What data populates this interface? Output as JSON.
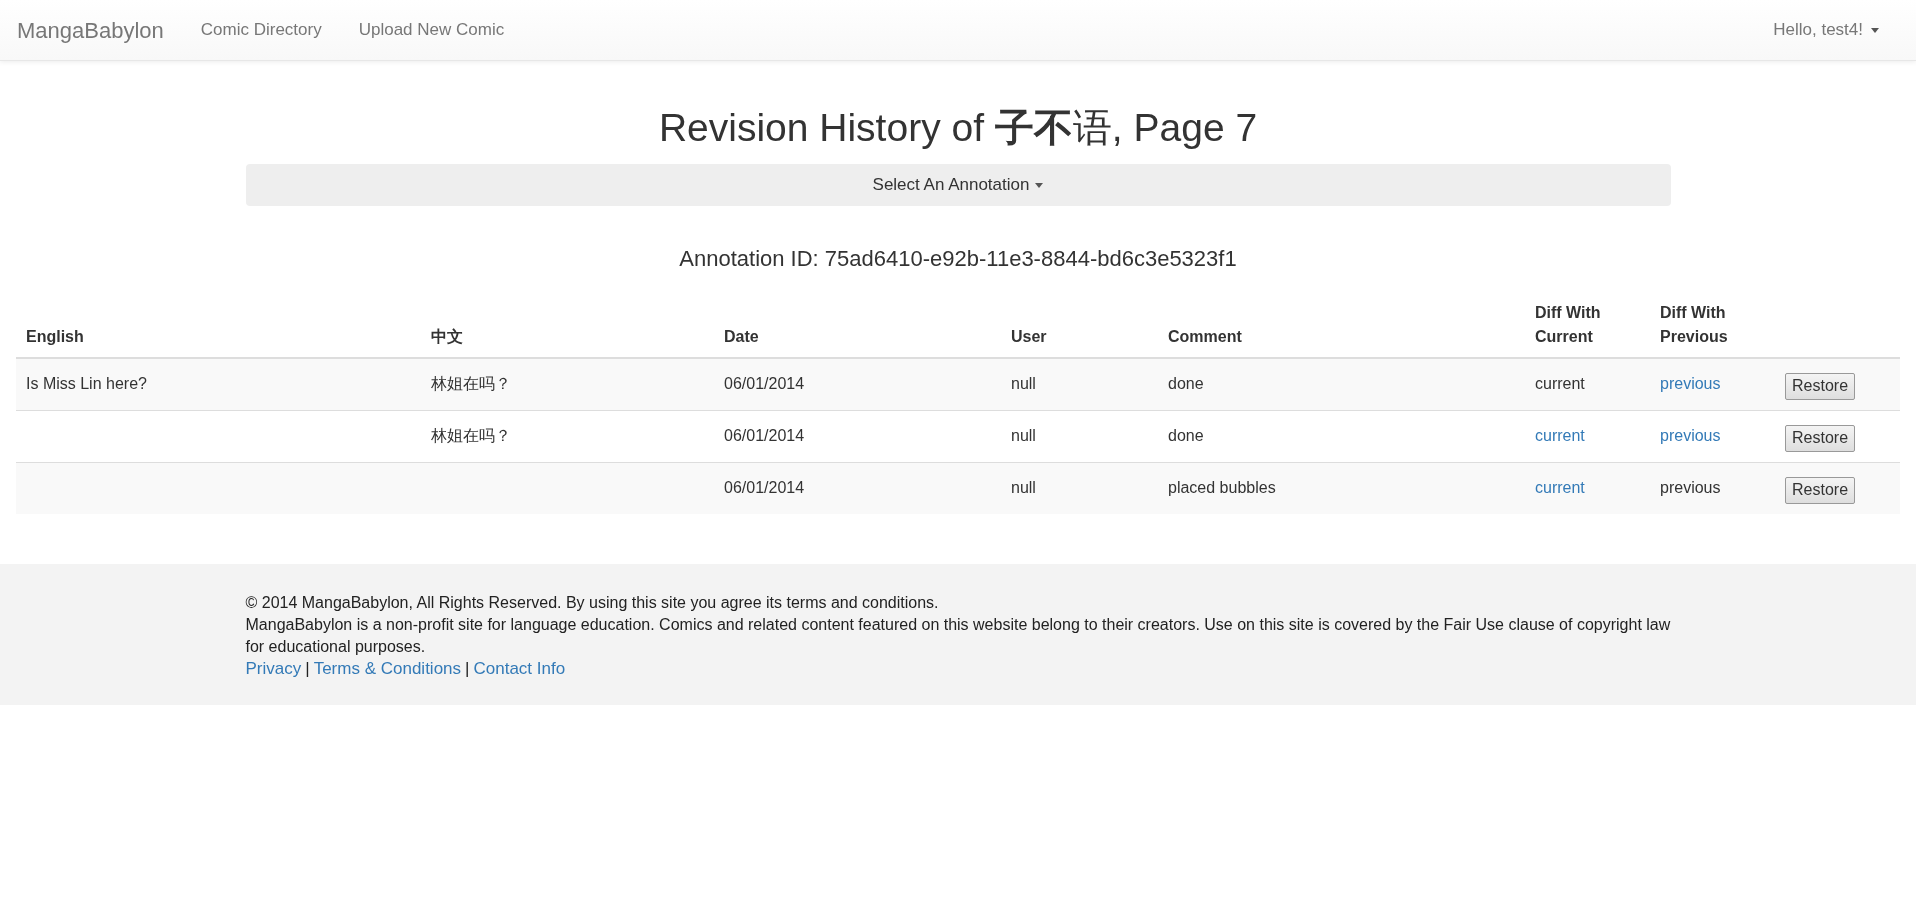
{
  "navbar": {
    "brand": "MangaBabylon",
    "links": [
      "Comic Directory",
      "Upload New Comic"
    ],
    "user_menu": "Hello, test4!"
  },
  "title": "Revision History of **子不**语, Page 7",
  "annotation_select": "Select An Annotation",
  "annotation_id": "Annotation ID: 75ad6410-e92b-11e3-8844-bd6c3e5323f1",
  "table": {
    "columns": [
      "English",
      "中文",
      "Date",
      "User",
      "Comment",
      "Diff With Current",
      "Diff With Previous"
    ],
    "rows": [
      {
        "english": "Is Miss Lin here?",
        "chinese": "林姐在吗？",
        "date": "06/01/2014",
        "user": "null",
        "comment": "done",
        "diff_current": {
          "text": "current",
          "linked": false
        },
        "diff_previous": {
          "text": "previous",
          "linked": true
        },
        "action": "Restore"
      },
      {
        "chinese": "林姐在吗？",
        "date": "06/01/2014",
        "user": "null",
        "comment": "done",
        "diff_current": {
          "text": "current",
          "linked": true
        },
        "diff_previous": {
          "text": "previous",
          "linked": true
        },
        "action": "Restore"
      },
      {
        "date": "06/01/2014",
        "user": "null",
        "comment": "placed bubbles",
        "diff_current": {
          "text": "current",
          "linked": true
        },
        "diff_previous": {
          "text": "previous",
          "linked": false
        },
        "action": "Restore"
      }
    ]
  },
  "footer": {
    "lines": [
      "© 2014 MangaBabylon, All Rights Reserved. By using this site you agree its terms and conditions.",
      "MangaBabylon is a non-profit site for language education. Comics and related content featured on this website belong to their creators. Use on this site is covered by the Fair Use clause of copyright law for educational purposes."
    ],
    "links": [
      {
        "kind": "link",
        "text": "Privacy"
      },
      {
        "kind": "separator",
        "text": "|"
      },
      {
        "kind": "link",
        "text": "Terms & Conditions"
      },
      {
        "kind": "separator",
        "text": "|"
      },
      {
        "kind": "link",
        "text": "Contact Info"
      }
    ]
  }
}
